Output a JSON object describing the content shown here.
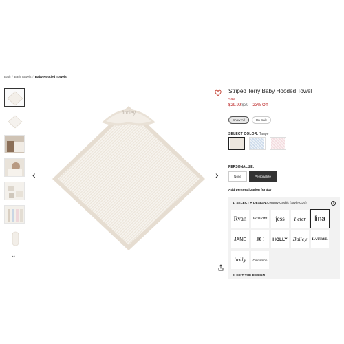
{
  "breadcrumb": [
    "Bath",
    "Bath Towels",
    "Baby Hooded Towels"
  ],
  "product": {
    "title": "Striped Terry Baby Hooded Towel",
    "sale_label": "Sale",
    "price_now": "$29.99",
    "price_was": "$39",
    "discount": "23% Off",
    "image_monogram": "finnley"
  },
  "filters": [
    "Show All",
    "On Sale"
  ],
  "color": {
    "label": "SELECT COLOR:",
    "value": "Taupe",
    "swatches": [
      {
        "name": "Taupe",
        "color": "#ece6de"
      },
      {
        "name": "Blue",
        "color": "#cddbeb"
      },
      {
        "name": "Pink",
        "color": "#f3dcdf"
      }
    ]
  },
  "personalize": {
    "label": "PERSONALIZE:",
    "options": [
      "None",
      "Personalize"
    ],
    "selected": "Personalize",
    "add_text": "Add personalization for $17"
  },
  "design": {
    "step1_label": "1. SELECT A DESIGN:",
    "step1_value": "Century Gothic (Style G36)",
    "fonts": [
      "Ryan",
      "William",
      "jess",
      "Peter",
      "lina",
      "JANE",
      "JC",
      "HOLLY",
      "Bailey",
      "LAURYL",
      "holly",
      "Cinnamon"
    ],
    "selected_font": "lina",
    "step2_label": "2. EDIT THE DESIGN"
  },
  "icons": {
    "heart": "heart-icon",
    "share": "share-icon",
    "info": "info-icon",
    "prev": "chevron-left-icon",
    "next": "chevron-right-icon",
    "thumbs_more": "chevron-down-icon"
  }
}
